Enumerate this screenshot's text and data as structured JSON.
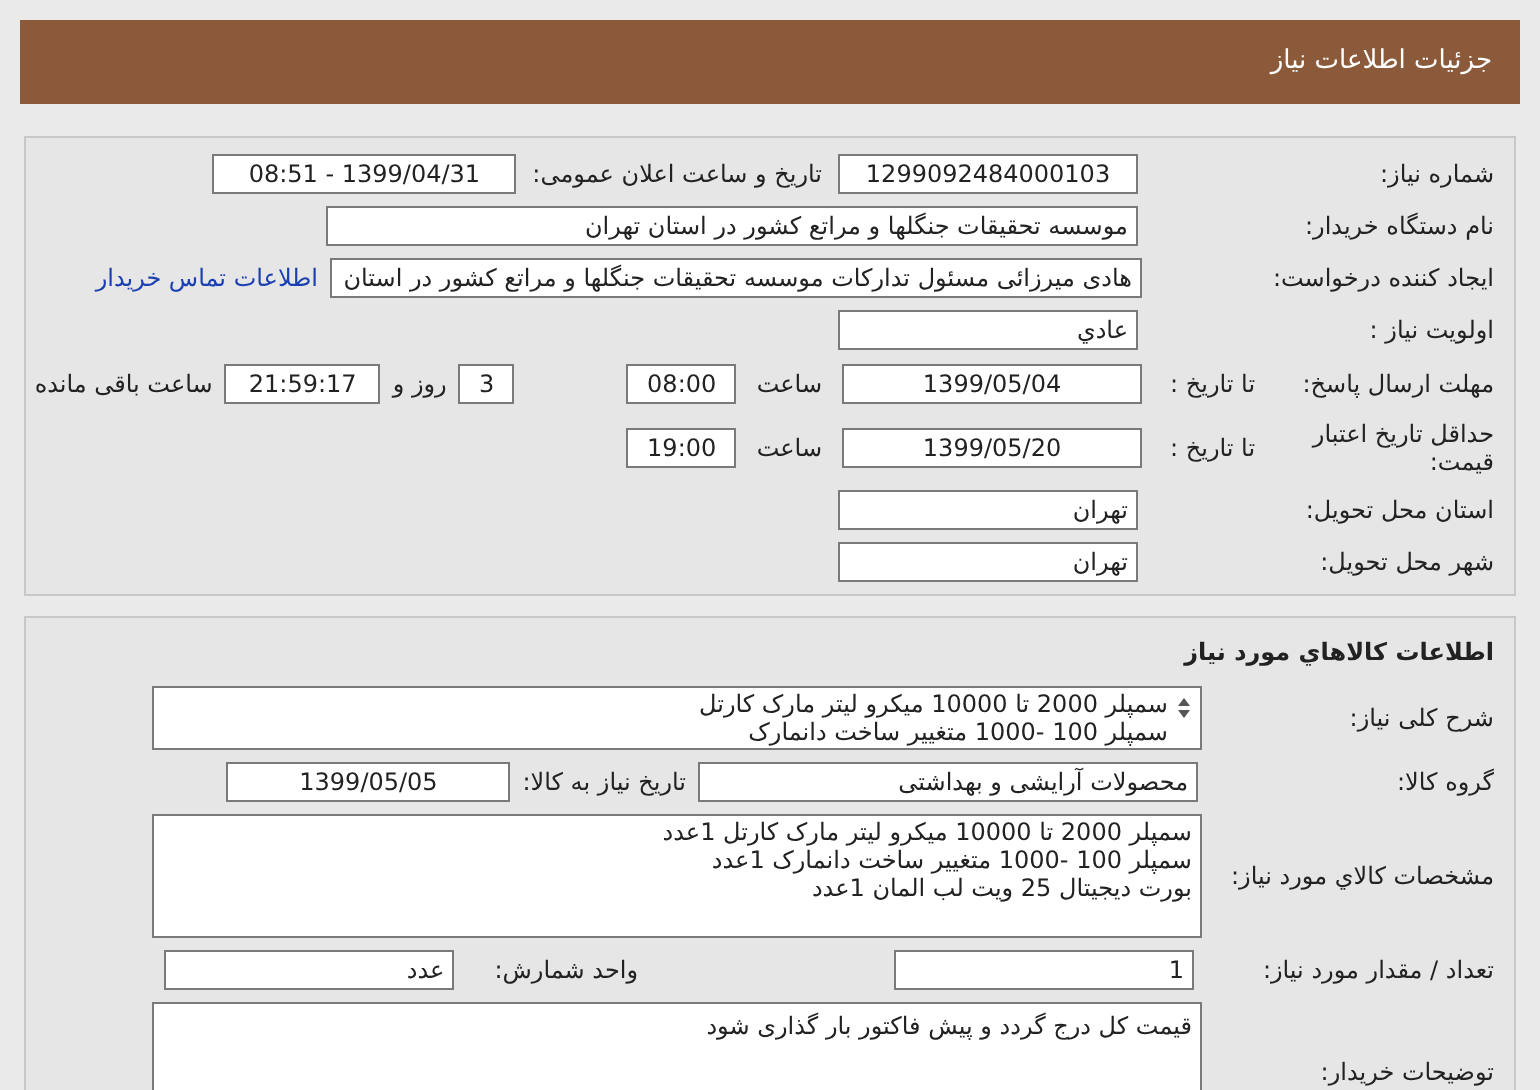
{
  "header": {
    "title": "جزئیات اطلاعات نیاز"
  },
  "summary": {
    "need_number": {
      "label": "شماره نیاز:",
      "value": "1299092484000103"
    },
    "announce": {
      "label": "تاریخ و ساعت اعلان عمومی:",
      "value": "1399/04/31 - 08:51"
    },
    "buyer": {
      "label": "نام دستگاه خریدار:",
      "value": "موسسه تحقیقات جنگلها و مراتع کشور در استان تهران"
    },
    "requester": {
      "label": "ایجاد کننده درخواست:",
      "value": "هادی میرزائی مسئول تدارکات موسسه تحقیقات جنگلها و مراتع کشور در استان",
      "link": "اطلاعات تماس خریدار"
    },
    "priority": {
      "label": "اولویت نیاز :",
      "value": "عادي"
    },
    "deadline": {
      "label": "مهلت ارسال پاسخ:",
      "to_label": "تا تاریخ :",
      "date": "1399/05/04",
      "time_label": "ساعت",
      "time": "08:00",
      "days": "3",
      "days_label": "روز و",
      "remaining": "21:59:17",
      "remaining_label": "ساعت باقی مانده"
    },
    "validity": {
      "label": "حداقل تاریخ اعتبار قیمت:",
      "to_label": "تا تاریخ :",
      "date": "1399/05/20",
      "time_label": "ساعت",
      "time": "19:00"
    },
    "province": {
      "label": "استان محل تحویل:",
      "value": "تهران"
    },
    "city": {
      "label": "شهر محل تحویل:",
      "value": "تهران"
    }
  },
  "goods": {
    "title": "اطلاعات كالاهاي مورد نیاز",
    "description": {
      "label": "شرح کلی نیاز:",
      "lines": [
        "سمپلر 2000 تا 10000 میکرو لیتر مارک کارتل",
        "سمپلر 100 -1000 متغییر ساخت دانمارک"
      ]
    },
    "group": {
      "label": "گروه کالا:",
      "value": "محصولات آرایشی و بهداشتی",
      "need_date_label": "تاریخ نیاز به کالا:",
      "need_date": "1399/05/05"
    },
    "specs": {
      "label": "مشخصات كالاي مورد نیاز:",
      "lines": [
        "سمپلر 2000 تا 10000 میکرو لیتر مارک کارتل   1عدد",
        "سمپلر 100 -1000 متغییر ساخت دانمارک  1عدد",
        "بورت دیجیتال 25 ویت لب المان  1عدد"
      ]
    },
    "quantity": {
      "label": "تعداد / مقدار مورد نیاز:",
      "value": "1",
      "unit_label": "واحد شمارش:",
      "unit": "عدد"
    },
    "buyer_notes": {
      "label": "توضیحات خریدار:",
      "value": "قیمت کل درج گردد و پیش فاکتور بار  گذاری شود"
    }
  }
}
